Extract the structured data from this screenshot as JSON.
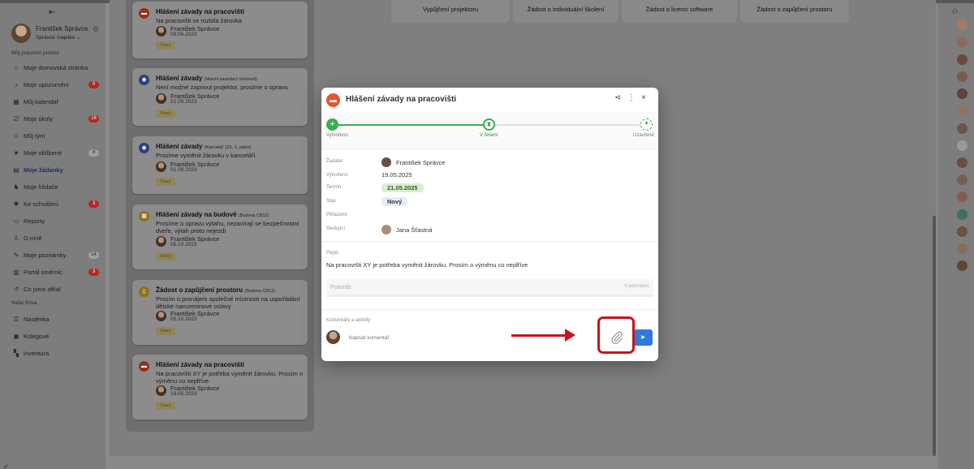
{
  "sidebar": {
    "user": {
      "name": "František Správce",
      "role": "Správce majetku"
    },
    "section_workspace": "Můj pracovní prostor",
    "items": [
      {
        "label": "Moje domovská stránka",
        "icon": "home-icon"
      },
      {
        "label": "Moje upozornění",
        "icon": "bell-icon",
        "badge": "0"
      },
      {
        "label": "Můj kalendář",
        "icon": "calendar-icon"
      },
      {
        "label": "Moje úkoly",
        "icon": "tasks-icon",
        "badge": "16"
      },
      {
        "label": "Můj tým",
        "icon": "team-icon"
      },
      {
        "label": "Moje oblíbené",
        "icon": "star-icon",
        "badge": "4"
      },
      {
        "label": "Moje žádanky",
        "icon": "requests-icon"
      },
      {
        "label": "Moje hlídače",
        "icon": "watchdog-icon"
      },
      {
        "label": "Ke schválení",
        "icon": "approve-icon",
        "badge": "3"
      },
      {
        "label": "Reporty",
        "icon": "reports-icon"
      },
      {
        "label": "O mně",
        "icon": "person-icon"
      },
      {
        "label": "Moje poznámky",
        "icon": "notes-icon",
        "badge": "14"
      },
      {
        "label": "Portál směrnic",
        "icon": "portal-icon",
        "badge": "3"
      },
      {
        "label": "Co jsem dělal",
        "icon": "history-icon"
      }
    ],
    "section_company": "Naše firma",
    "company_items": [
      {
        "label": "Nástěnka",
        "icon": "board-icon"
      },
      {
        "label": "Kolegové",
        "icon": "colleagues-icon"
      },
      {
        "label": "Inventura",
        "icon": "inventory-icon"
      }
    ]
  },
  "request_buttons": [
    "Vypůjčení projektoru",
    "Žádost o individuální školení",
    "Žádost o licenci software",
    "Žádost o zapůjčení prostoru"
  ],
  "cards": [
    {
      "title": "Hlášení závady na pracovišti",
      "sub": "",
      "desc": "Na pracovišti se rozbila žárovka",
      "person": "František Správce",
      "date": "09.06.2023",
      "badge": "Nový"
    },
    {
      "title": "Hlášení závady",
      "sub": "(Hlavní zasedací místnost)",
      "desc": "Není možné zapnout projektor, prosíme o opravu",
      "person": "František Správce",
      "date": "01.09.2023",
      "badge": "Nový"
    },
    {
      "title": "Hlášení závady",
      "sub": "(Kancelář 121, 1. patro)",
      "desc": "Prosíme vyměnit žárovku v kanceláři.",
      "person": "František Správce",
      "date": "01.09.2023",
      "badge": "Nový"
    },
    {
      "title": "Hlášení závady na budově",
      "sub": "(Budova CB12)",
      "desc": "Prosíme o opravu výtahu, nezavírají se bezpečnostní dveře, výtah proto nejezdí",
      "person": "František Správce",
      "date": "05.10.2023",
      "badge": "Nový"
    },
    {
      "title": "Žádost o zapůjčení prostoru",
      "sub": "(Budova CB12)",
      "desc": "Prosím o pronájem společné místnosti na uspořádání dětské narozeninové oslavy",
      "person": "František Správce",
      "date": "05.10.2023",
      "badge": "Nový"
    },
    {
      "title": "Hlášení závady na pracovišti",
      "sub": "",
      "desc": "Na pracovišti XY je potřeba vyměnit žárovku. Prosím o výměnu co nejdříve",
      "person": "František Správce",
      "date": "19.05.2023",
      "badge": "Nový"
    }
  ],
  "modal": {
    "title": "Hlášení závady na pracovišti",
    "steps": [
      {
        "label": "Vytvořeno",
        "state": "done"
      },
      {
        "label": "V řešení",
        "state": "current"
      },
      {
        "label": "Uzavřené",
        "state": "todo"
      }
    ],
    "fields": {
      "requester_label": "Žadatel",
      "requester": "František Správce",
      "created_label": "Vytvořeno",
      "created": "19.05.2025",
      "deadline_label": "Termín",
      "deadline": "21.05.2025",
      "status_label": "Stav",
      "status": "Nový",
      "assigned_label": "Přiřazeno",
      "assigned": "",
      "watchers_label": "Sledující",
      "watcher": "Jana Šťastná"
    },
    "description_label": "Popis",
    "description": "Na pracovišti XY je potřeba vyměnit žárovku. Prosím o výměnu co nejdříve",
    "confirm_label": "Potvrdit",
    "confirm_count": "0 potvrzení",
    "comments_label": "Komentáře a aktivity",
    "comment_placeholder": "Napsat komentář"
  },
  "colors": {
    "accent": "#2d7bd8",
    "success": "#35b14a",
    "danger": "#c8141a",
    "brand": "#e8542d"
  }
}
